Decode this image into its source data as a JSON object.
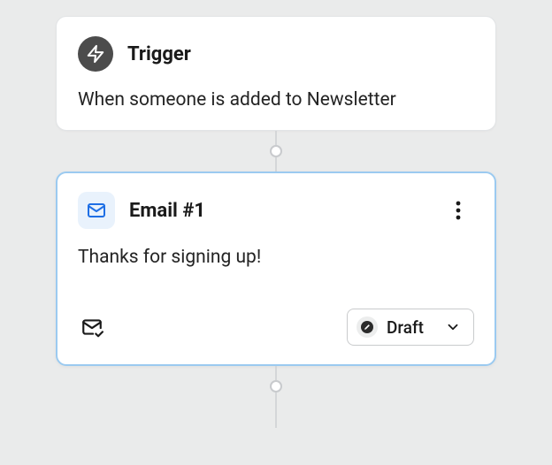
{
  "trigger": {
    "title": "Trigger",
    "description": "When someone is added to Newsletter"
  },
  "email": {
    "title": "Email #1",
    "subject": "Thanks for signing up!",
    "status_label": "Draft"
  },
  "icons": {
    "trigger": "lightning-icon",
    "email": "mail-icon",
    "approve": "mail-check-icon",
    "status_bullet": "pencil-circle-icon",
    "more": "dots-vertical-icon",
    "chevron": "chevron-down-icon"
  }
}
